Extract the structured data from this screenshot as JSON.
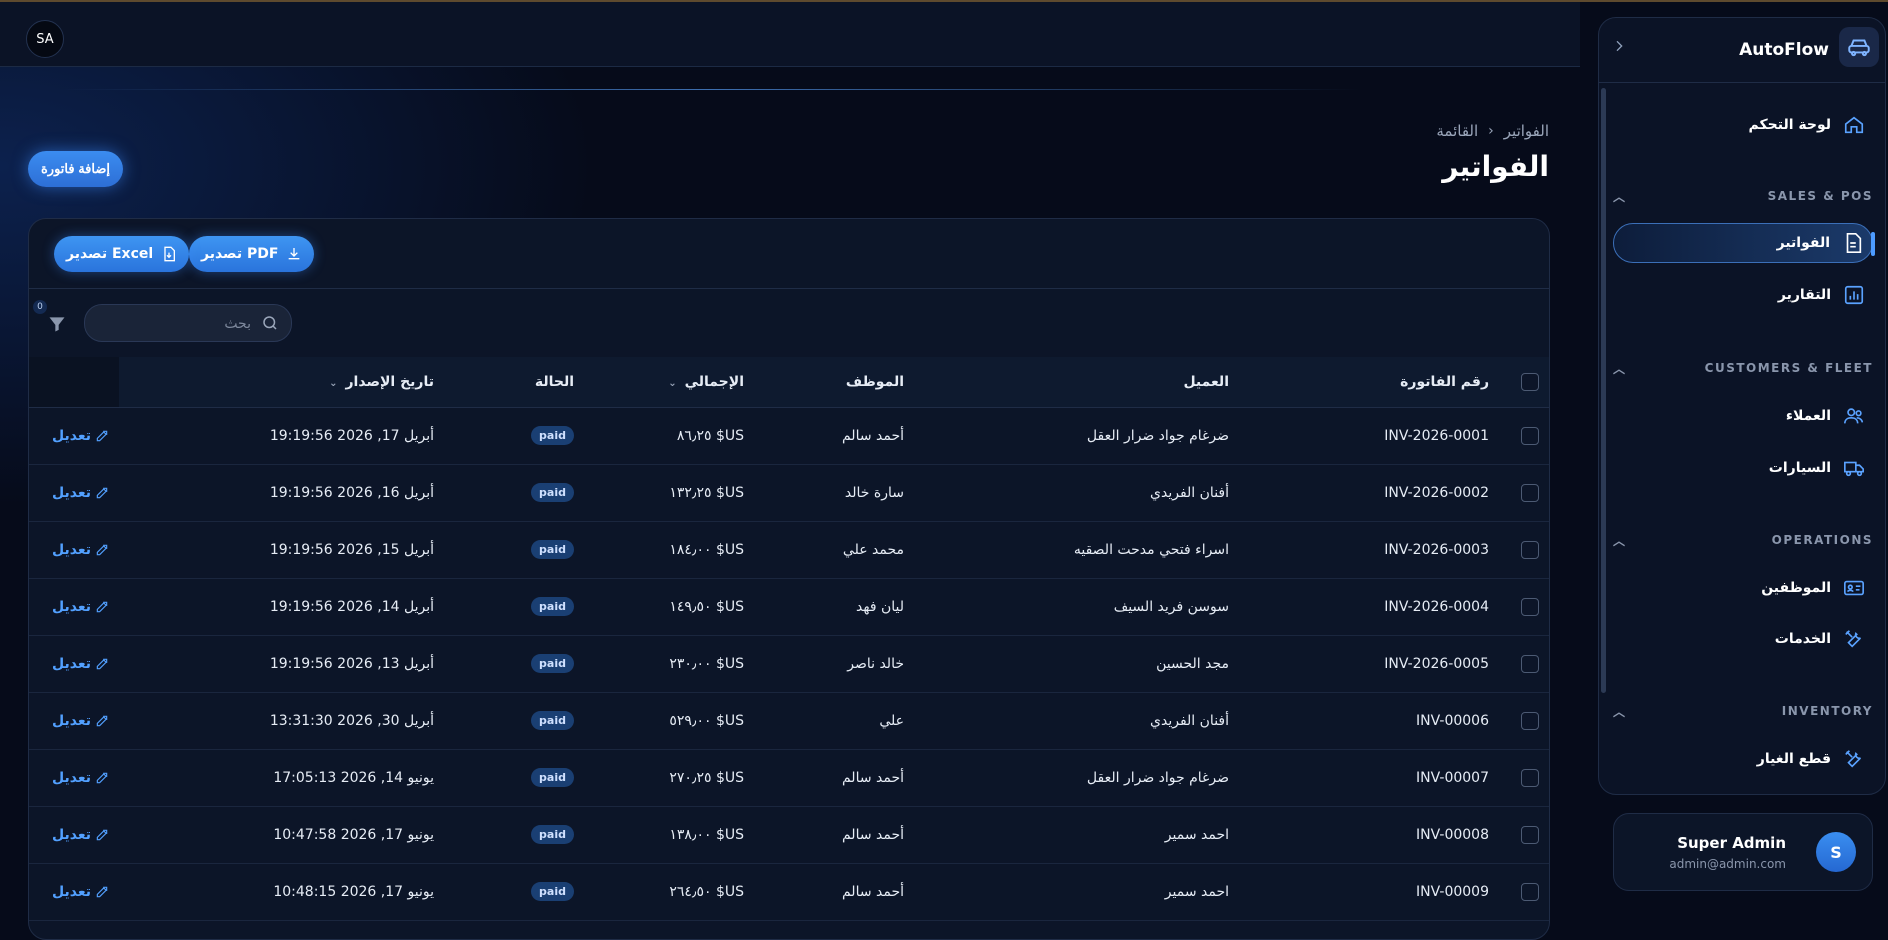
{
  "topbar": {
    "avatar_initials": "SA"
  },
  "breadcrumb": {
    "root": "الفواتير",
    "current": "القائمة"
  },
  "page": {
    "title": "الفواتير",
    "add_label": "إضافة فاتورة"
  },
  "toolbar": {
    "export_pdf": "تصدير PDF",
    "export_excel": "تصدير Excel"
  },
  "search": {
    "placeholder": "بحث",
    "filter_count": "0"
  },
  "table": {
    "headers": {
      "invoice_no": "رقم الفاتورة",
      "customer": "العميل",
      "employee": "الموظف",
      "total": "الإجمالي",
      "status": "الحالة",
      "issue_date": "تاريخ الإصدار"
    },
    "rows": [
      {
        "invoice_no": "INV-2026-0001",
        "customer": "ضرغام جواد ضرار العقل",
        "employee": "أحمد سالم",
        "total": "‏US$ ٨٦٫٢٥",
        "status": "paid",
        "issue_date": "أبريل 17, 2026 19:19:56",
        "edit": "تعديل"
      },
      {
        "invoice_no": "INV-2026-0002",
        "customer": "أفنان الفريدي",
        "employee": "سارة خالد",
        "total": "‏US$ ١٣٢٫٢٥",
        "status": "paid",
        "issue_date": "أبريل 16, 2026 19:19:56",
        "edit": "تعديل"
      },
      {
        "invoice_no": "INV-2026-0003",
        "customer": "اسراء فتحي مدحت الصقيه",
        "employee": "محمد علي",
        "total": "‏US$ ١٨٤٫٠٠",
        "status": "paid",
        "issue_date": "أبريل 15, 2026 19:19:56",
        "edit": "تعديل"
      },
      {
        "invoice_no": "INV-2026-0004",
        "customer": "سوسن فريد السيف",
        "employee": "ليان فهد",
        "total": "‏US$ ١٤٩٫٥٠",
        "status": "paid",
        "issue_date": "أبريل 14, 2026 19:19:56",
        "edit": "تعديل"
      },
      {
        "invoice_no": "INV-2026-0005",
        "customer": "مجد الحسين",
        "employee": "خالد ناصر",
        "total": "‏US$ ٢٣٠٫٠٠",
        "status": "paid",
        "issue_date": "أبريل 13, 2026 19:19:56",
        "edit": "تعديل"
      },
      {
        "invoice_no": "INV-00006",
        "customer": "أفنان الفريدي",
        "employee": "علي",
        "total": "‏US$ ٥٢٩٫٠٠",
        "status": "paid",
        "issue_date": "أبريل 30, 2026 13:31:30",
        "edit": "تعديل"
      },
      {
        "invoice_no": "INV-00007",
        "customer": "ضرغام جواد ضرار العقل",
        "employee": "أحمد سالم",
        "total": "‏US$ ٢٧٠٫٢٥",
        "status": "paid",
        "issue_date": "يونيو 14, 2026 17:05:13",
        "edit": "تعديل"
      },
      {
        "invoice_no": "INV-00008",
        "customer": "احمد سمير",
        "employee": "أحمد سالم",
        "total": "‏US$ ١٣٨٫٠٠",
        "status": "paid",
        "issue_date": "يونيو 17, 2026 10:47:58",
        "edit": "تعديل"
      },
      {
        "invoice_no": "INV-00009",
        "customer": "احمد سمير",
        "employee": "أحمد سالم",
        "total": "‏US$ ٢٦٤٫٥٠",
        "status": "paid",
        "issue_date": "يونيو 17, 2026 10:48:15",
        "edit": "تعديل"
      }
    ]
  },
  "sidebar": {
    "brand": "AutoFlow",
    "dashboard": "لوحة التحكم",
    "sections": {
      "sales": "SALES & POS",
      "customers": "CUSTOMERS & FLEET",
      "operations": "OPERATIONS",
      "inventory": "INVENTORY"
    },
    "items": {
      "invoices": "الفواتير",
      "reports": "التقارير",
      "clients": "العملاء",
      "cars": "السيارات",
      "employees": "الموظفين",
      "services": "الخدمات",
      "parts": "قطع الغيار"
    }
  },
  "user": {
    "name": "Super Admin",
    "email": "admin@admin.com",
    "initial": "S"
  },
  "colors": {
    "accent": "#3b8cf0",
    "background": "#060b1a",
    "card": "#0c1528",
    "edit_link": "#52a0ff",
    "paid_badge": "#1a3f73"
  }
}
